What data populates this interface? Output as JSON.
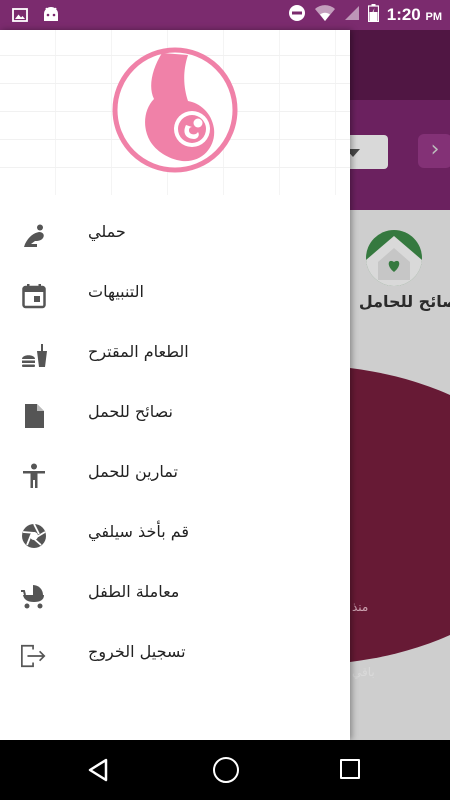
{
  "status_bar": {
    "time": "1:20",
    "ampm": "PM",
    "icons": [
      "image-icon",
      "android-icon",
      "dnd-icon",
      "wifi-icon",
      "signal-icon",
      "battery-charging-icon"
    ]
  },
  "colors": {
    "status_bar": "#7b2b6e",
    "brand_pink": "#f081a8",
    "toolbar": "#5e1a4f",
    "icon_grey": "#555555"
  },
  "drawer": {
    "logo": "pregnancy-logo-icon",
    "items": [
      {
        "label": "حملي",
        "icon": "pregnant-woman-icon"
      },
      {
        "label": "التنبيهات",
        "icon": "calendar-icon"
      },
      {
        "label": "الطعام المقترح",
        "icon": "fastfood-icon"
      },
      {
        "label": "نصائح للحمل",
        "icon": "document-icon"
      },
      {
        "label": "تمارين للحمل",
        "icon": "accessibility-icon"
      },
      {
        "label": "قم بأخذ سيلفي",
        "icon": "camera-shutter-icon"
      },
      {
        "label": "معاملة الطفل",
        "icon": "baby-stroller-icon"
      },
      {
        "label": "تسجيل الخروج",
        "icon": "logout-icon"
      }
    ]
  },
  "background": {
    "tips_label": "نصائح للحامل",
    "circle_text": "منذ",
    "bottom_text": "باقي"
  }
}
